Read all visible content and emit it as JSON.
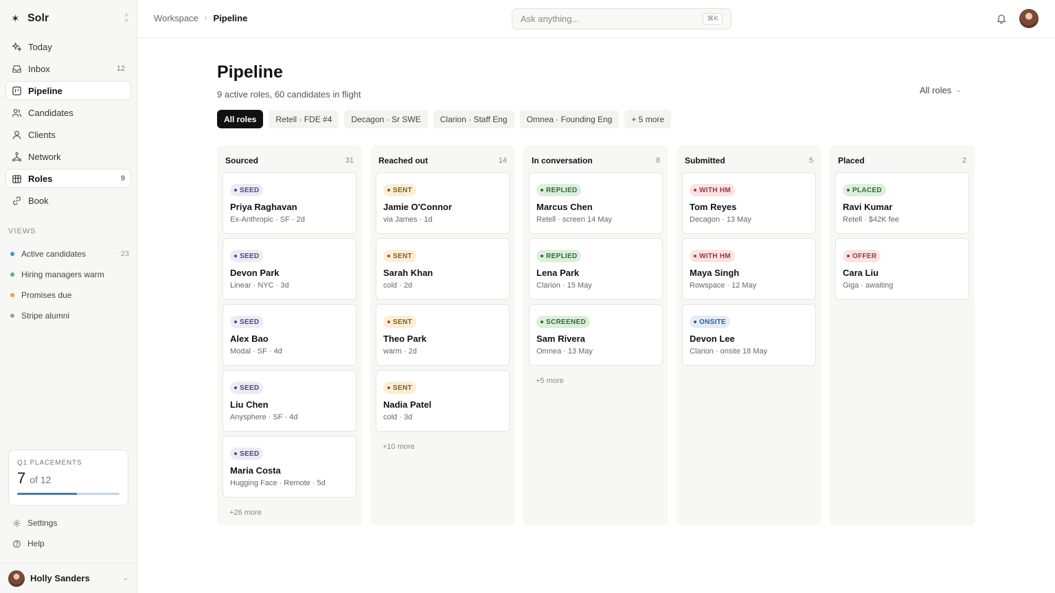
{
  "app": {
    "name": "Solr"
  },
  "nav": [
    {
      "label": "Today",
      "count": "",
      "icon": "sparkle-icon"
    },
    {
      "label": "Inbox",
      "count": "12",
      "icon": "inbox-icon"
    },
    {
      "label": "Pipeline",
      "count": "",
      "icon": "kanban-icon",
      "active": true
    },
    {
      "label": "Candidates",
      "count": "",
      "icon": "users-icon"
    },
    {
      "label": "Clients",
      "count": "",
      "icon": "building-icon"
    },
    {
      "label": "Network",
      "count": "",
      "icon": "network-icon"
    },
    {
      "label": "Roles",
      "count": "9",
      "icon": "briefcase-icon"
    },
    {
      "label": "Book",
      "count": "",
      "icon": "link-icon"
    }
  ],
  "views": {
    "label": "VIEWS",
    "items": [
      {
        "label": "Active candidates",
        "count": "· 23",
        "color": "#4a8fd6"
      },
      {
        "label": "Hiring managers warm",
        "count": "",
        "color": "#5bb56a"
      },
      {
        "label": "Promises due",
        "count": "",
        "color": "#e8a23a"
      },
      {
        "label": "Stripe alumni",
        "count": "",
        "color": "#9a9a9a"
      }
    ]
  },
  "placements": {
    "label": "Q1 PLACEMENTS",
    "value": "7",
    "of": "of 12",
    "progress": 0.583
  },
  "footer": {
    "settings": "Settings",
    "help": "Help"
  },
  "user": {
    "name": "Holly Sanders"
  },
  "breadcrumb": {
    "parent": "Workspace",
    "current": "Pipeline"
  },
  "search": {
    "placeholder": "Ask anything...",
    "shortcut": "⌘K"
  },
  "page": {
    "title": "Pipeline",
    "subtitle": "9 active roles, 60 candidates in flight",
    "roles_filter": "All roles"
  },
  "chips": [
    {
      "label": "All roles",
      "active": true
    },
    {
      "label": "Retell · FDE #4"
    },
    {
      "label": "Decagon · Sr SWE"
    },
    {
      "label": "Clarion · Staff Eng"
    },
    {
      "label": "Omnea · Founding Eng"
    },
    {
      "label": "+ 5 more"
    }
  ],
  "columns": [
    {
      "title": "Sourced",
      "count": "31",
      "more": "+26 more",
      "cards": [
        {
          "badge": "SEED",
          "tone": "seed",
          "name": "Priya Raghavan",
          "meta": "Ex-Anthropic · SF · 2d"
        },
        {
          "badge": "SEED",
          "tone": "seed",
          "name": "Devon Park",
          "meta": "Linear · NYC · 3d"
        },
        {
          "badge": "SEED",
          "tone": "seed",
          "name": "Alex Bao",
          "meta": "Modal · SF · 4d"
        },
        {
          "badge": "SEED",
          "tone": "seed",
          "name": "Liu Chen",
          "meta": "Anysphere · SF · 4d"
        },
        {
          "badge": "SEED",
          "tone": "seed",
          "name": "Maria Costa",
          "meta": "Hugging Face · Remote · 5d"
        }
      ]
    },
    {
      "title": "Reached out",
      "count": "14",
      "more": "+10 more",
      "cards": [
        {
          "badge": "SENT",
          "tone": "sent",
          "name": "Jamie O'Connor",
          "meta": "via James · 1d"
        },
        {
          "badge": "SENT",
          "tone": "sent",
          "name": "Sarah Khan",
          "meta": "cold · 2d"
        },
        {
          "badge": "SENT",
          "tone": "sent",
          "name": "Theo Park",
          "meta": "warm · 2d"
        },
        {
          "badge": "SENT",
          "tone": "sent",
          "name": "Nadia Patel",
          "meta": "cold · 3d"
        }
      ]
    },
    {
      "title": "In conversation",
      "count": "8",
      "more": "+5 more",
      "cards": [
        {
          "badge": "REPLIED",
          "tone": "green",
          "name": "Marcus Chen",
          "meta": "Retell · screen 14 May"
        },
        {
          "badge": "REPLIED",
          "tone": "green",
          "name": "Lena Park",
          "meta": "Clarion · 15 May"
        },
        {
          "badge": "SCREENED",
          "tone": "green",
          "name": "Sam Rivera",
          "meta": "Omnea · 13 May"
        }
      ]
    },
    {
      "title": "Submitted",
      "count": "5",
      "more": "",
      "cards": [
        {
          "badge": "WITH HM",
          "tone": "red",
          "name": "Tom Reyes",
          "meta": "Decagon · 13 May"
        },
        {
          "badge": "WITH HM",
          "tone": "red",
          "name": "Maya Singh",
          "meta": "Rowspace · 12 May"
        },
        {
          "badge": "ONSITE",
          "tone": "blue",
          "name": "Devon Lee",
          "meta": "Clarion · onsite 18 May"
        }
      ]
    },
    {
      "title": "Placed",
      "count": "2",
      "more": "",
      "cards": [
        {
          "badge": "PLACED",
          "tone": "green",
          "name": "Ravi Kumar",
          "meta": "Retell · $42K fee"
        },
        {
          "badge": "OFFER",
          "tone": "red",
          "name": "Cara Liu",
          "meta": "Giga · awaiting"
        }
      ]
    }
  ]
}
